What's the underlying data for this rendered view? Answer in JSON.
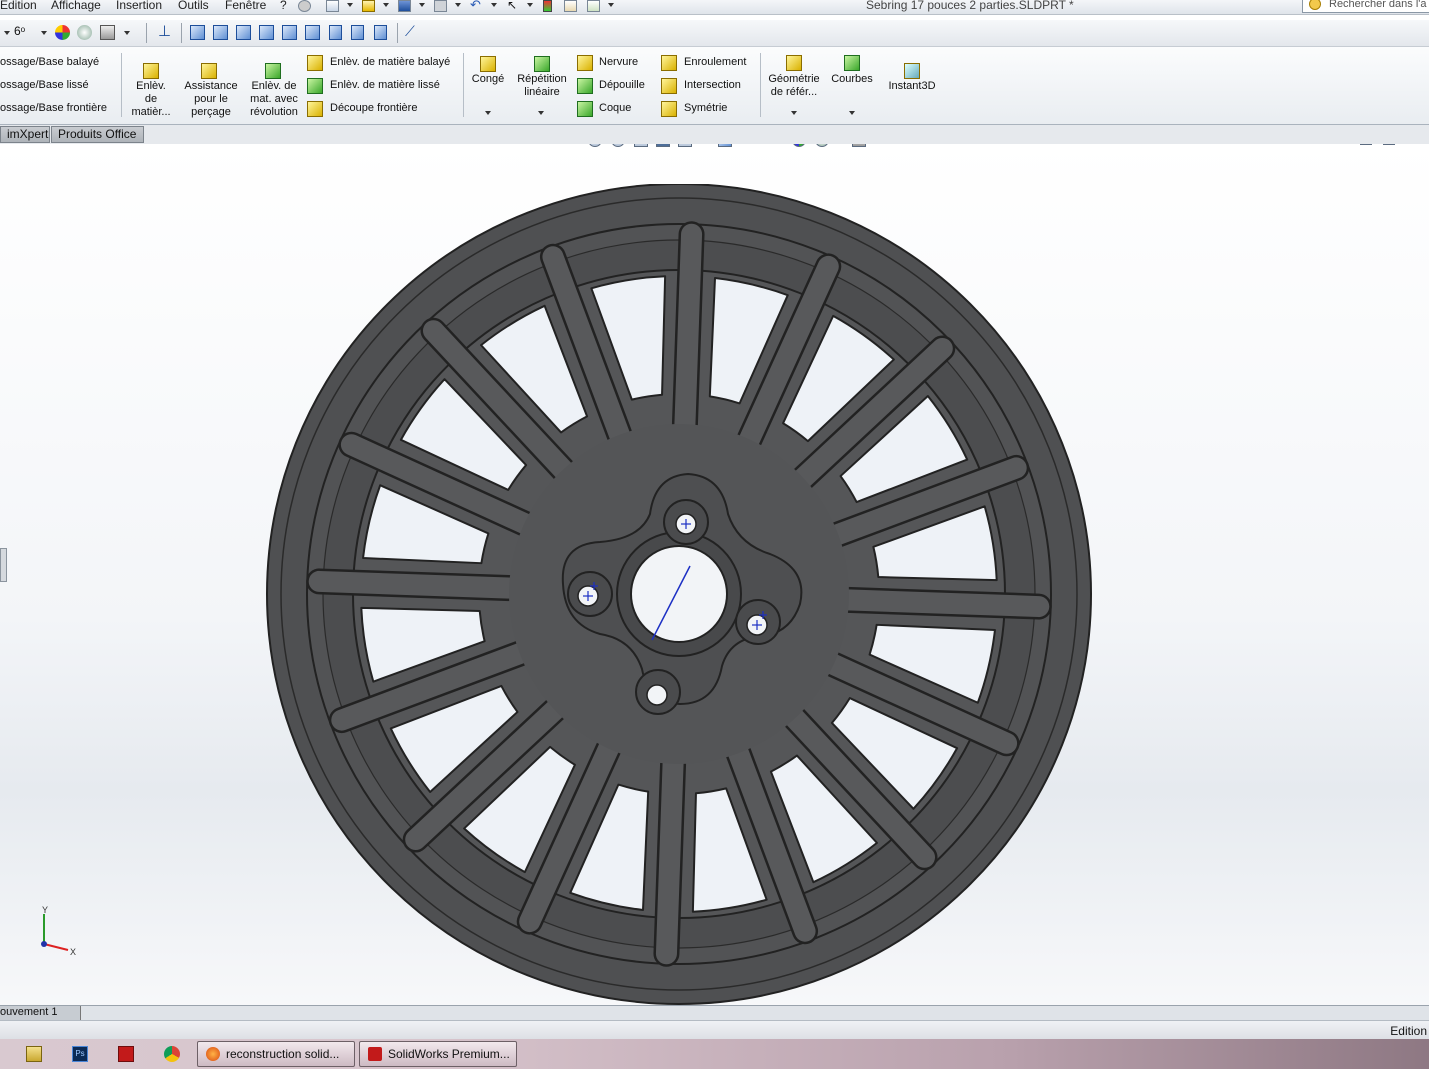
{
  "menubar": {
    "items": [
      "Edition",
      "Affichage",
      "Insertion",
      "Outils",
      "Fenêtre",
      "?"
    ],
    "document_title": "Sebring 17 pouces 2 parties.SLDPRT *",
    "search_placeholder": "Rechercher dans l'a"
  },
  "ribbon": {
    "left_column": [
      "ossage/Base balayé",
      "ossage/Base lissé",
      "ossage/Base frontière"
    ],
    "big_buttons": [
      {
        "label": "Enlèv.\nde\nmatièr..."
      },
      {
        "label": "Assistance\npour le\nperçage"
      },
      {
        "label": "Enlèv. de\nmat. avec\nrévolution"
      }
    ],
    "cut_column": [
      "Enlèv. de matière balayé",
      "Enlèv. de matière lissé",
      "Découpe frontière"
    ],
    "features": {
      "conge": "Congé",
      "repetition": "Répétition\nlinéaire",
      "col1": [
        "Nervure",
        "Dépouille",
        "Coque"
      ],
      "col2": [
        "Enroulement",
        "Intersection",
        "Symétrie"
      ]
    },
    "reference": {
      "geometrie": "Géométrie\nde référ...",
      "courbes": "Courbes",
      "instant3d": "Instant3D"
    }
  },
  "tabs": [
    "imXpert",
    "Produits Office"
  ],
  "model_tab": "ouvement 1",
  "status": "Edition",
  "taskbar": {
    "windows": [
      "reconstruction solid...",
      "SolidWorks Premium..."
    ]
  },
  "triad": {
    "x_label": "X",
    "y_label": "Y"
  }
}
